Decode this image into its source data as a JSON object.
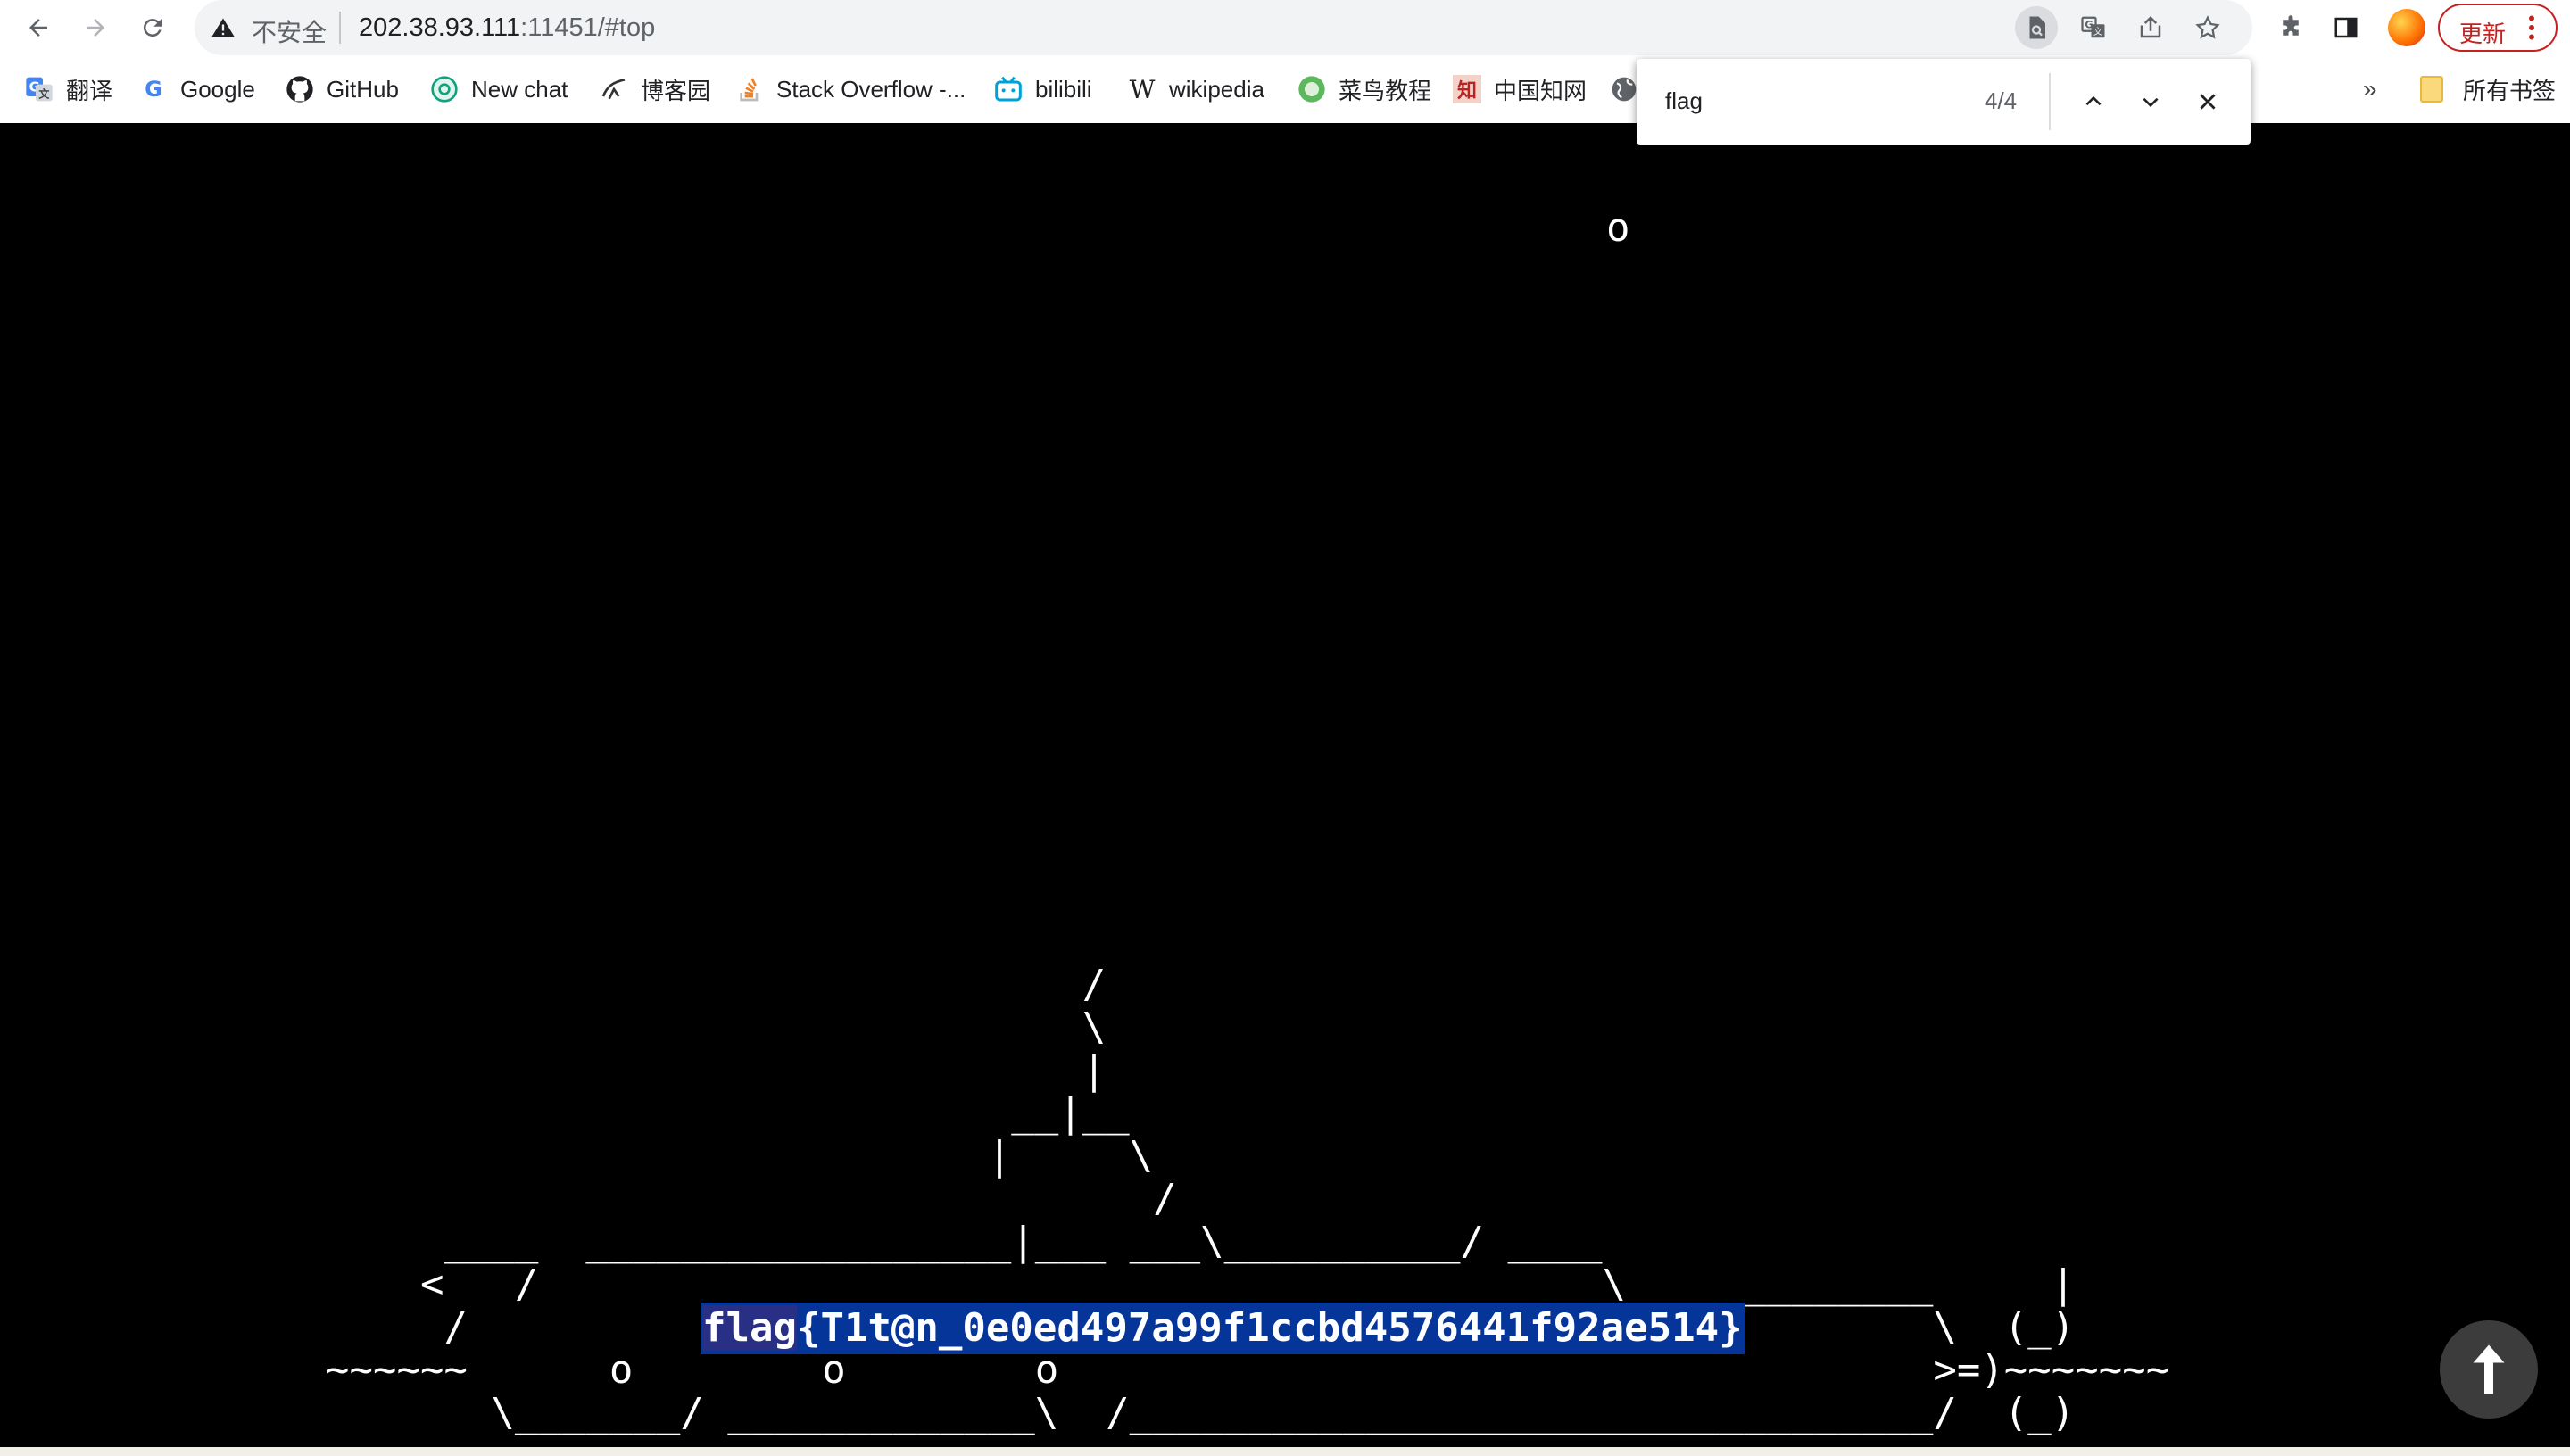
{
  "browser": {
    "security_label": "不安全",
    "url_host": "202.38.93.111",
    "url_rest": ":11451/#top",
    "update_label": "更新"
  },
  "bookmarks": [
    {
      "label": "翻译",
      "icon": "google-translate-icon"
    },
    {
      "label": "Google",
      "icon": "google-icon"
    },
    {
      "label": "GitHub",
      "icon": "github-icon"
    },
    {
      "label": "New chat",
      "icon": "openai-icon"
    },
    {
      "label": "博客园",
      "icon": "cnblogs-icon"
    },
    {
      "label": "Stack Overflow -...",
      "icon": "stackoverflow-icon"
    },
    {
      "label": "bilibili",
      "icon": "bilibili-icon"
    },
    {
      "label": "wikipedia",
      "icon": "wikipedia-icon"
    },
    {
      "label": "菜鸟教程",
      "icon": "runoob-icon"
    },
    {
      "label": "中国知网",
      "icon": "cnki-icon"
    }
  ],
  "all_bookmarks_label": "所有书签",
  "overflow_label": "»",
  "find": {
    "query": "flag",
    "count": "4/4"
  },
  "page": {
    "bubble": "o",
    "flag_prefix": "flag",
    "flag_rest": "{T1t@n_0e0ed497a99f1ccbd4576441f92ae514}",
    "ascii_art": "                                /\n                                \\\n                                |\n                             __|__\n                            |     \\\n                                   /\n     ____  __________________|___ ___\\__________/ ____\n    <   /                                             \\_____________     |\n     /                                                              \\  (_)\n~~~~~~      o        o        o                                     >=)~~~~~~~\n       \\_______/ _____________\\  /__________________________________/  (_)"
  },
  "colors": {
    "background": "#000000",
    "find_highlight": "#06359a",
    "update_red": "#c5221f"
  }
}
